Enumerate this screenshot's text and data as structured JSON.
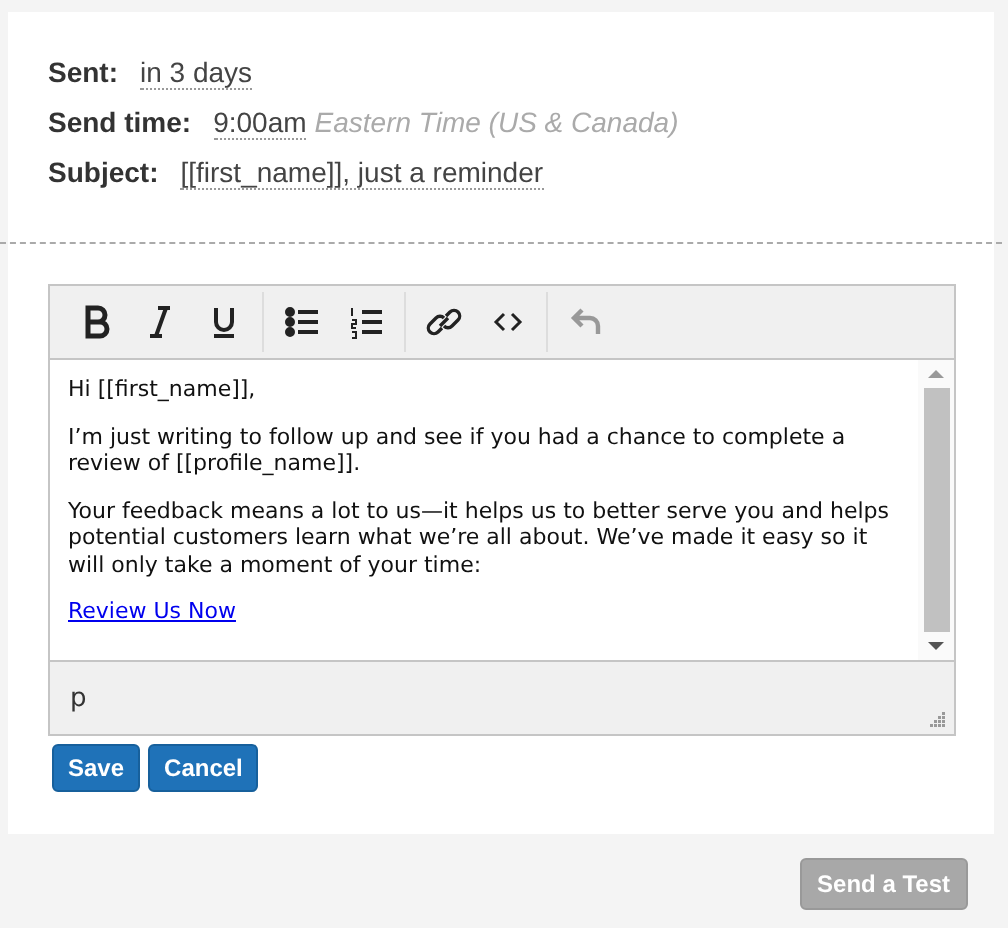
{
  "details": [
    {
      "label": "Sent:",
      "value": "in 3 days"
    },
    {
      "label": "Send time:",
      "value": "9:00am",
      "note": "Eastern Time (US & Canada)"
    },
    {
      "label": "Subject:",
      "value": "[[first_name]], just a reminder"
    }
  ],
  "editor": {
    "toolbar": [
      [
        {
          "kind": "bold",
          "disabled": false
        },
        {
          "kind": "italic",
          "disabled": false
        },
        {
          "kind": "underline",
          "disabled": false
        }
      ],
      [
        {
          "kind": "bullets",
          "disabled": false
        },
        {
          "kind": "numbers",
          "disabled": false
        }
      ],
      [
        {
          "kind": "link",
          "disabled": false
        },
        {
          "kind": "code",
          "disabled": false
        }
      ],
      [
        {
          "kind": "undo",
          "disabled": true
        }
      ]
    ],
    "paragraphs": [
      {
        "kind": "text",
        "text": "Hi [[first_name]],"
      },
      {
        "kind": "text",
        "text": "I’m just writing to follow up and see if you had a chance to complete a review of [[profile_name]]."
      },
      {
        "kind": "text",
        "text": "Your feedback means a lot to us—it helps us to better serve you and helps potential customers learn what we’re all about. We’ve made it easy so it will only take a moment of your time:"
      },
      {
        "kind": "link",
        "text": "Review Us Now"
      }
    ],
    "path": "p"
  },
  "buttons": [
    "Save",
    "Cancel"
  ],
  "test_button": "Send a Test"
}
